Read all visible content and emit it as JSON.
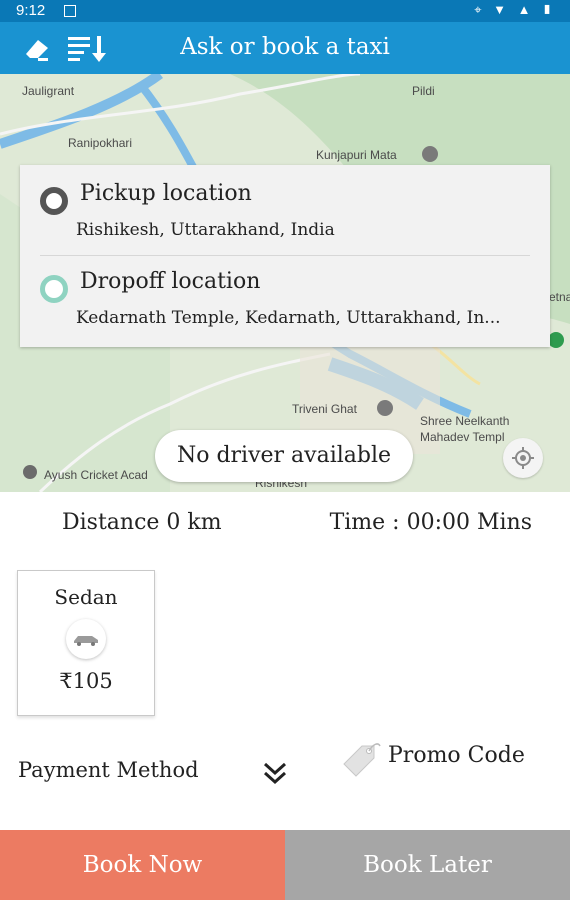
{
  "status_bar": {
    "time": "9:12",
    "icons": "⌖ ▼ ▲ ▮"
  },
  "app_bar": {
    "title": "Ask or book a taxi"
  },
  "map": {
    "labels": [
      "Jauligrant",
      "Ranipokhari",
      "Kunjapuri Mata",
      "Pildi",
      "Triveni Ghat",
      "Shree Neelkanth",
      "Mahadev Templ",
      "Ayush Cricket Acad",
      "Rishikesh",
      "etna"
    ]
  },
  "pickup": {
    "title": "Pickup location",
    "value": "Rishikesh, Uttarakhand, India"
  },
  "dropoff": {
    "title": "Dropoff location",
    "value": "Kedarnath Temple, Kedarnath, Uttarakhand, In..."
  },
  "status_text": "No driver available",
  "trip": {
    "distance": "Distance 0 km",
    "time": "Time : 00:00 Mins"
  },
  "vehicle": {
    "name": "Sedan",
    "price": "₹105"
  },
  "payment_label": "Payment Method",
  "promo_label": "Promo Code",
  "buttons": {
    "book_now": "Book Now",
    "book_later": "Book Later"
  },
  "colors": {
    "app_bar": "#1a93d1",
    "book_now": "#ec7b62",
    "book_later": "#a6a6a6",
    "dropoff_ring": "#8fd3c1",
    "pickup_ring": "#555555"
  }
}
